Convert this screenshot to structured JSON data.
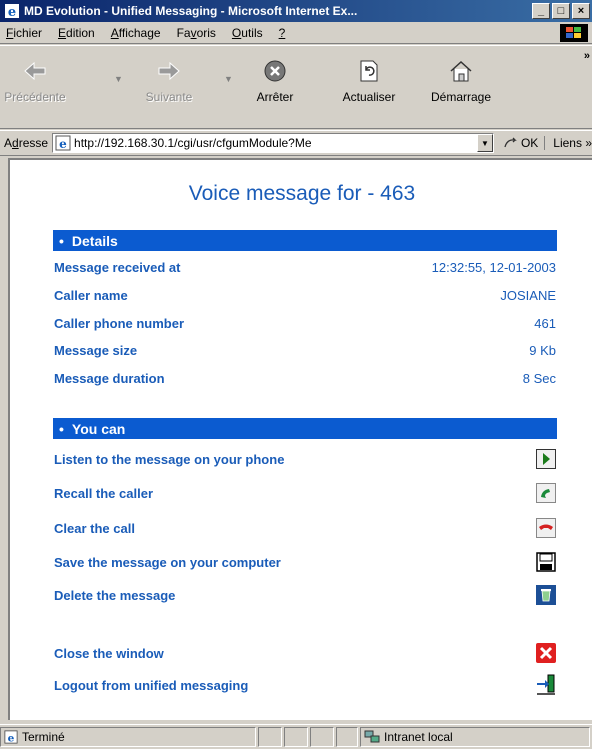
{
  "window": {
    "title": "MD Evolution - Unified Messaging - Microsoft Internet Ex...",
    "minimize": "_",
    "maximize": "□",
    "close": "×"
  },
  "menu": {
    "items": [
      {
        "accel": "F",
        "rest": "ichier"
      },
      {
        "accel": "E",
        "rest": "dition"
      },
      {
        "accel": "A",
        "rest": "ffichage"
      },
      {
        "pre": "Fa",
        "accel": "v",
        "rest": "oris"
      },
      {
        "accel": "O",
        "rest": "utils"
      },
      {
        "accel": "?",
        "rest": ""
      }
    ]
  },
  "toolbar": {
    "back": "Précédente",
    "forward": "Suivante",
    "stop": "Arrêter",
    "refresh": "Actualiser",
    "home": "Démarrage",
    "more": "»"
  },
  "address": {
    "label_pre": "A",
    "label_accel": "d",
    "label_rest": "resse",
    "url": "http://192.168.30.1/cgi/usr/cfgumModule?Me",
    "go": "OK",
    "links": "Liens »"
  },
  "page": {
    "title": "Voice message for - 463",
    "details": {
      "bullet": "•",
      "header": "Details",
      "rows": [
        {
          "label": "Message received at",
          "value": "12:32:55, 12-01-2003"
        },
        {
          "label": "Caller name",
          "value": "JOSIANE"
        },
        {
          "label": "Caller phone number",
          "value": "461"
        },
        {
          "label": "Message size",
          "value": "9 Kb"
        },
        {
          "label": "Message duration",
          "value": "8 Sec"
        }
      ]
    },
    "actions": {
      "bullet": "•",
      "header": "You can",
      "items": [
        {
          "label": "Listen to the message on your phone",
          "icon": "play-icon"
        },
        {
          "label": "Recall the caller",
          "icon": "phone-call-icon"
        },
        {
          "label": "Clear the call",
          "icon": "phone-hangup-icon"
        },
        {
          "label": "Save the message on your computer",
          "icon": "floppy-disk-icon"
        },
        {
          "label": "Delete the message",
          "icon": "trash-icon"
        },
        {
          "label": "Close the window",
          "icon": "close-window-icon"
        },
        {
          "label": "Logout from unified messaging",
          "icon": "logout-icon"
        }
      ]
    }
  },
  "status": {
    "text": "Terminé",
    "zone": "Intranet local"
  },
  "colors": {
    "accent": "#0b5bd0",
    "link_text": "#1a5cb8"
  }
}
